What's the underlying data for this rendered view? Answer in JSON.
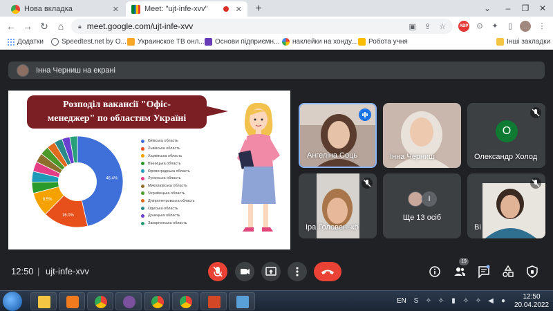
{
  "browser": {
    "tabs": [
      {
        "title": "Нова вкладка",
        "active": false
      },
      {
        "title": "Meet: \"ujt-infe-xvv\"",
        "active": true
      }
    ],
    "new_tab": "+",
    "window_controls": [
      "⌄",
      "–",
      "❐",
      "✕"
    ],
    "url": "meet.google.com/ujt-infe-xvv",
    "abp_label": "ABP",
    "bookmarks": [
      {
        "label": "Додатки",
        "icon": "apps-icon",
        "color": "#4285f4"
      },
      {
        "label": "Speedtest.net by O...",
        "icon": "speedtest-icon",
        "color": "#5f6368"
      },
      {
        "label": "Украинское ТВ онл...",
        "icon": "tv-icon",
        "color": "#f9a825"
      },
      {
        "label": "Основи підприємн...",
        "icon": "doc-icon",
        "color": "#673ab7"
      },
      {
        "label": "наклейки на хонду...",
        "icon": "google-icon",
        "color": "#ea4335"
      },
      {
        "label": "Робота учня",
        "icon": "classroom-icon",
        "color": "#fbbc04"
      }
    ],
    "other_bookmarks": "Інші закладки"
  },
  "meet": {
    "presenter_banner": "Інна Черниш на екрані",
    "slide": {
      "title_line1": "Розподіл вакансії \"Офіс-",
      "title_line2": "менеджер\" по областям Україні"
    },
    "participants": [
      {
        "name": "Ангеліна Соць",
        "muted": false,
        "speaking": true
      },
      {
        "name": "Інна Черниш",
        "muted": false,
        "speaking": false
      },
      {
        "name": "Олександр Холод",
        "muted": true,
        "initial": "О"
      },
      {
        "name": "Іра Головенько",
        "muted": true
      },
      {
        "name": "Ще 13 осіб",
        "initial": "І"
      },
      {
        "name": "Ві",
        "muted": true
      }
    ],
    "time": "12:50",
    "separator": "|",
    "code": "ujt-infe-xvv",
    "participant_count": "19"
  },
  "chart_data": {
    "type": "pie",
    "title": "Розподіл вакансії \"Офіс-менеджер\" по областям Україні",
    "categories": [
      "Київська область",
      "Львівська область",
      "Харківська область",
      "Вінницька область",
      "Кіровоградська область",
      "Луганська область",
      "Миколаївська область",
      "Чернівецька область",
      "Дніпропетровська область",
      "Одеська область",
      "Донецька область",
      "Закарпатська область"
    ],
    "values": [
      46.4,
      16.0,
      8.5,
      4.0,
      3.8,
      3.5,
      3.3,
      3.1,
      3.0,
      2.9,
      2.8,
      2.7
    ],
    "labels_shown": [
      "46.4%",
      "16.0%",
      "8.5%",
      "",
      "",
      "",
      "",
      "",
      "",
      "",
      "",
      ""
    ],
    "colors": [
      "#3f6fd8",
      "#e8501b",
      "#f5a200",
      "#2a9a2a",
      "#1f9ab8",
      "#e63e86",
      "#8c6f2c",
      "#4c9a2a",
      "#e06b1f",
      "#2a8a8a",
      "#6a3fd0",
      "#2aa07a"
    ],
    "donut": true,
    "legend_position": "right"
  },
  "taskbar": {
    "language": "EN",
    "clock_time": "12:50",
    "clock_date": "20.04.2022"
  }
}
